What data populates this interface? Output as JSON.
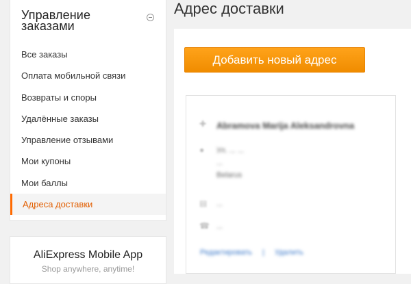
{
  "sidebar": {
    "title": "Управление заказами",
    "items": [
      {
        "label": "Все заказы"
      },
      {
        "label": "Оплата мобильной связи"
      },
      {
        "label": "Возвраты и споры"
      },
      {
        "label": "Удалённые заказы"
      },
      {
        "label": "Управление отзывами"
      },
      {
        "label": "Мои купоны"
      },
      {
        "label": "Мои баллы"
      },
      {
        "label": "Адреса доставки"
      }
    ],
    "active_index": 7
  },
  "app_card": {
    "title": "AliExpress Mobile App",
    "subtitle": "Shop anywhere, anytime!"
  },
  "main": {
    "title": "Адрес доставки",
    "add_button": "Добавить новый адрес",
    "address": {
      "name": "Abramova Marija Aleksandrovna",
      "line1": "Ул. ...   ...",
      "line2": "...",
      "line3": "Belarus",
      "zip": "...",
      "phone": "...",
      "edit_link": "Редактировать",
      "delete_link": "Удалить"
    }
  },
  "colors": {
    "accent": "#ff6a00",
    "button": "#f59a0b",
    "link": "#3a78c9"
  }
}
